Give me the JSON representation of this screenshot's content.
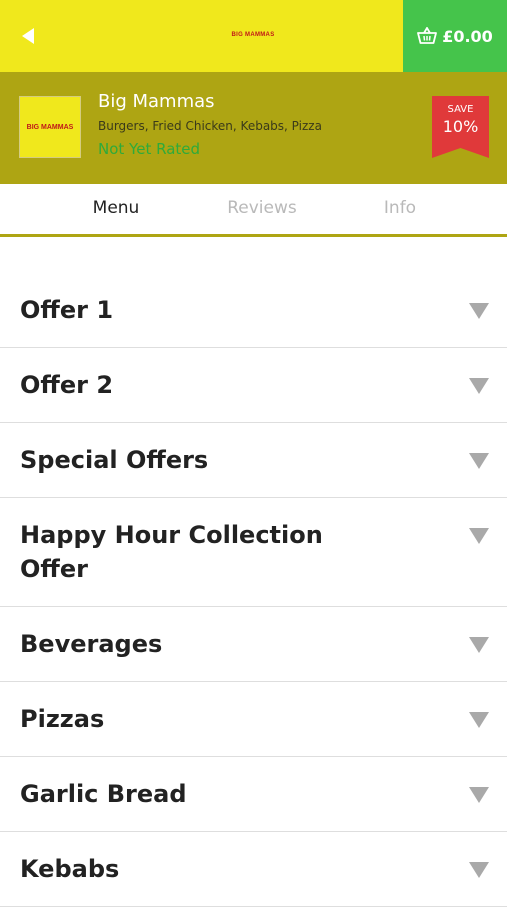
{
  "header": {
    "logo_text": "BIG MAMMAS",
    "cart_total": "£0.00",
    "icons": {
      "back": "back-arrow-icon",
      "cart": "basket-icon"
    },
    "colors": {
      "topbar": "#f0e81c",
      "cart_bg": "#45c44b"
    }
  },
  "restaurant": {
    "logo_text": "BIG MAMMAS",
    "name": "Big Mammas",
    "cuisine": "Burgers, Fried Chicken, Kebabs, Pizza",
    "rating": "Not Yet Rated",
    "save_label": "SAVE",
    "save_value": "10%",
    "colors": {
      "band": "#aea513",
      "rating": "#2faa3a",
      "save_badge": "#e0393a"
    }
  },
  "tabs": [
    {
      "label": "Menu",
      "active": true
    },
    {
      "label": "Reviews",
      "active": false
    },
    {
      "label": "Info",
      "active": false
    }
  ],
  "menu": {
    "categories": [
      {
        "label": "Offer 1"
      },
      {
        "label": "Offer 2"
      },
      {
        "label": "Special Offers"
      },
      {
        "label": "Happy Hour Collection Offer"
      },
      {
        "label": "Beverages"
      },
      {
        "label": "Pizzas"
      },
      {
        "label": "Garlic Bread"
      },
      {
        "label": "Kebabs"
      }
    ],
    "expand_icon": "chevron-down-icon"
  }
}
